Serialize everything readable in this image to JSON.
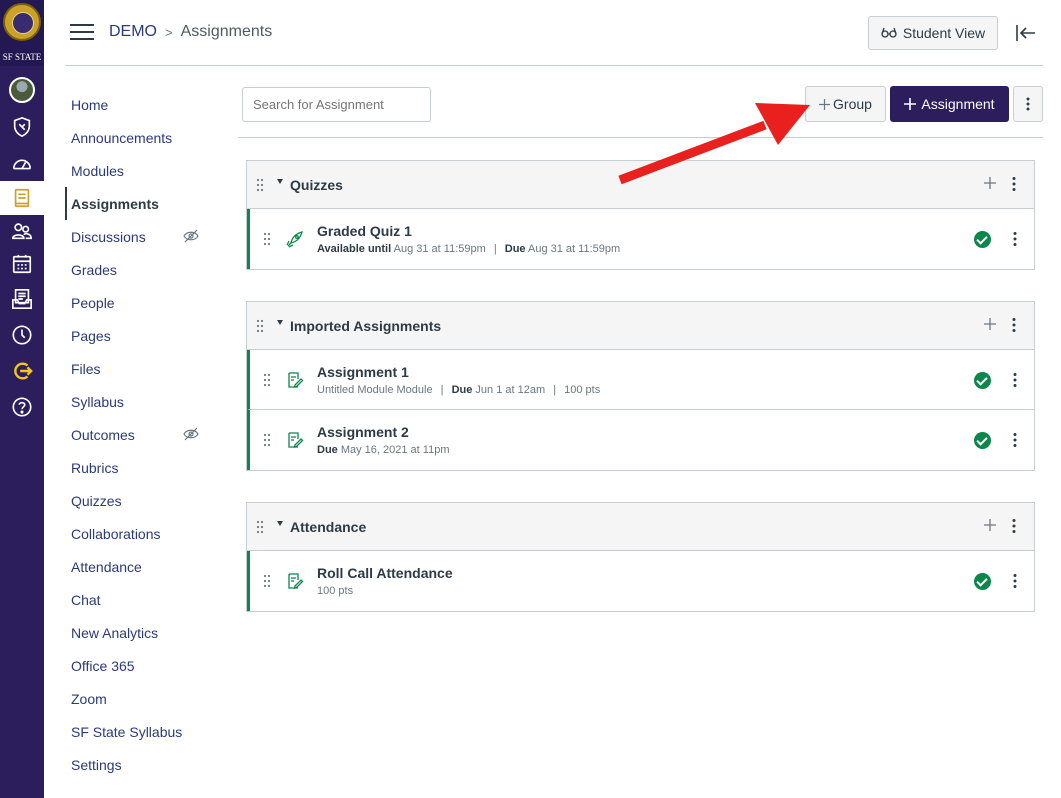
{
  "global_nav": {
    "logo_text": "SF STATE",
    "items": [
      {
        "icon": "account-avatar-icon"
      },
      {
        "icon": "admin-shield-icon"
      },
      {
        "icon": "dashboard-icon"
      },
      {
        "icon": "courses-icon",
        "active": true
      },
      {
        "icon": "groups-icon"
      },
      {
        "icon": "calendar-icon"
      },
      {
        "icon": "inbox-icon"
      },
      {
        "icon": "history-icon"
      },
      {
        "icon": "commons-icon"
      },
      {
        "icon": "help-icon"
      }
    ]
  },
  "header": {
    "course": "DEMO",
    "page": "Assignments",
    "student_view_label": "Student View"
  },
  "course_nav": [
    {
      "label": "Home"
    },
    {
      "label": "Announcements"
    },
    {
      "label": "Modules"
    },
    {
      "label": "Assignments",
      "active": true
    },
    {
      "label": "Discussions",
      "hidden": true
    },
    {
      "label": "Grades"
    },
    {
      "label": "People"
    },
    {
      "label": "Pages"
    },
    {
      "label": "Files"
    },
    {
      "label": "Syllabus"
    },
    {
      "label": "Outcomes",
      "hidden": true
    },
    {
      "label": "Rubrics"
    },
    {
      "label": "Quizzes"
    },
    {
      "label": "Collaborations"
    },
    {
      "label": "Attendance"
    },
    {
      "label": "Chat"
    },
    {
      "label": "New Analytics"
    },
    {
      "label": "Office 365"
    },
    {
      "label": "Zoom"
    },
    {
      "label": "SF State Syllabus"
    },
    {
      "label": "Settings"
    }
  ],
  "toolbar": {
    "search_placeholder": "Search for Assignment",
    "group_label": "Group",
    "assignment_label": "Assignment"
  },
  "groups": [
    {
      "title": "Quizzes",
      "items": [
        {
          "title": "Graded Quiz 1",
          "icon": "quiz-rocket-icon",
          "available_label": "Available until",
          "available_value": "Aug 31 at 11:59pm",
          "due_label": "Due",
          "due_value": "Aug 31 at 11:59pm",
          "published": true
        }
      ]
    },
    {
      "title": "Imported Assignments",
      "items": [
        {
          "title": "Assignment 1",
          "icon": "assignment-icon",
          "module": "Untitled Module Module",
          "due_label": "Due",
          "due_value": "Jun 1 at 12am",
          "points": "100 pts",
          "published": true
        },
        {
          "title": "Assignment 2",
          "icon": "assignment-icon",
          "due_label": "Due",
          "due_value": "May 16, 2021 at 11pm",
          "published": true
        }
      ]
    },
    {
      "title": "Attendance",
      "items": [
        {
          "title": "Roll Call Attendance",
          "icon": "assignment-icon",
          "points": "100 pts",
          "published": true
        }
      ]
    }
  ],
  "colors": {
    "brand": "#2c1e5c",
    "link": "#2b3a7a",
    "published": "#0b874b",
    "annotation_arrow": "#e8201e"
  }
}
